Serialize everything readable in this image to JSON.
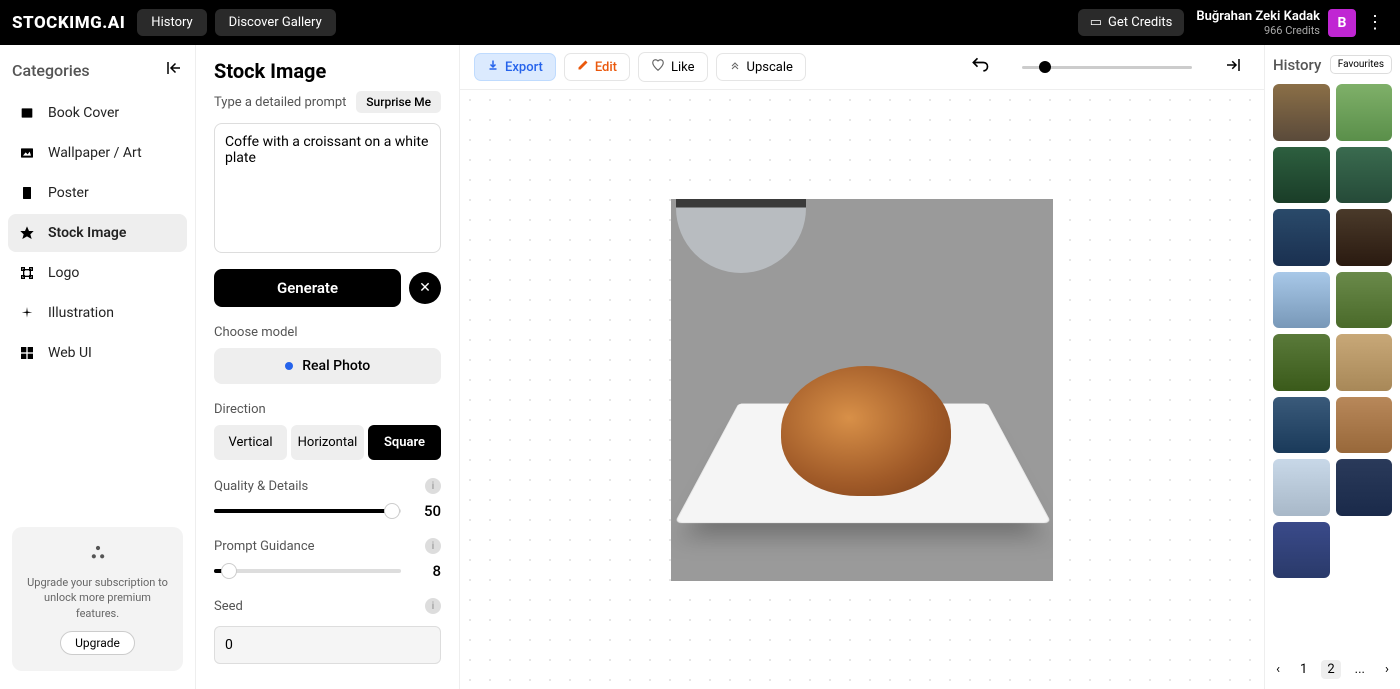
{
  "topbar": {
    "logo": "STOCKIMG.AI",
    "history": "History",
    "gallery": "Discover Gallery",
    "getcredits": "Get Credits",
    "username": "Buğrahan Zeki Kadak",
    "credits": "966 Credits",
    "avatar": "B"
  },
  "sidebar": {
    "title": "Categories",
    "items": [
      {
        "label": "Book Cover"
      },
      {
        "label": "Wallpaper / Art"
      },
      {
        "label": "Poster"
      },
      {
        "label": "Stock Image"
      },
      {
        "label": "Logo"
      },
      {
        "label": "Illustration"
      },
      {
        "label": "Web UI"
      }
    ],
    "upgrade_text": "Upgrade your subscription to unlock more premium features.",
    "upgrade_btn": "Upgrade"
  },
  "settings": {
    "title": "Stock Image",
    "subtitle": "Type a detailed prompt",
    "surprise": "Surprise Me",
    "prompt": "Coffe with a croissant on a white plate",
    "generate": "Generate",
    "model_label": "Choose model",
    "model_name": "Real Photo",
    "direction_label": "Direction",
    "directions": [
      "Vertical",
      "Horizontal",
      "Square"
    ],
    "quality_label": "Quality & Details",
    "quality_value": "50",
    "guidance_label": "Prompt Guidance",
    "guidance_value": "8",
    "seed_label": "Seed",
    "seed_value": "0"
  },
  "toolbar": {
    "export": "Export",
    "edit": "Edit",
    "like": "Like",
    "upscale": "Upscale"
  },
  "history": {
    "title": "History",
    "favourites": "Favourites",
    "pages": [
      "1",
      "2",
      "..."
    ]
  }
}
